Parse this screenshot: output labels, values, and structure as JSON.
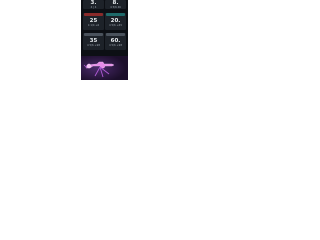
{
  "cards": [
    {
      "level": "3.",
      "meta": "4 | 4"
    },
    {
      "level": "8.",
      "meta": "4 5/6 46"
    },
    {
      "level": "25",
      "meta": "4 1/4 +6"
    },
    {
      "level": "20.",
      "meta": "4 5/6 +65"
    },
    {
      "level": "35",
      "meta": "4 5/6 +98"
    },
    {
      "level": "60.",
      "meta": "4 5/6 +98"
    }
  ],
  "colors": {
    "background": "#0c0f14",
    "card": "#1d2229",
    "tag_red": "#8a2a2a",
    "tag_teal": "#1f6b6b",
    "tag_gray": "#4a525c",
    "banner_purple": "#1c0f2b",
    "weapon_pink": "#e58ce8"
  },
  "banner": {
    "icon": "weapon-icon"
  }
}
